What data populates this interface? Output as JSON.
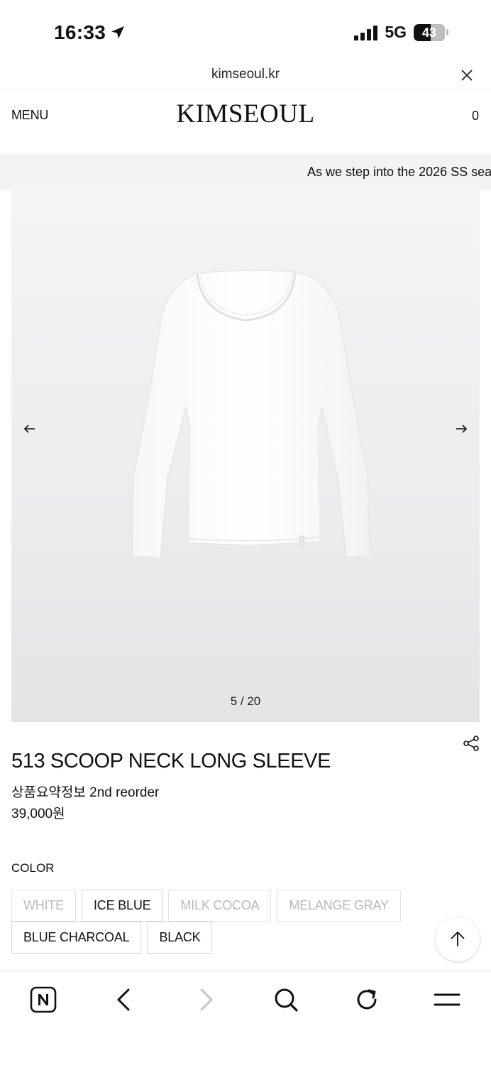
{
  "status_bar": {
    "time": "16:33",
    "network": "5G",
    "battery": "43",
    "icons": [
      "location-arrow-icon",
      "signal-icon",
      "battery-icon"
    ]
  },
  "browser": {
    "url": "kimseoul.kr",
    "close_icon": "close-icon"
  },
  "header": {
    "menu_label": "MENU",
    "logo": "KIMSEOUL",
    "cart_count": "0"
  },
  "marquee": {
    "text": "As we step into the 2026 SS sea"
  },
  "gallery": {
    "pager": "5 / 20",
    "current_index": 5,
    "total": 20,
    "prev_icon": "arrow-left-icon",
    "next_icon": "arrow-right-icon"
  },
  "product": {
    "name": "513 SCOOP NECK LONG SLEEVE",
    "subtitle": "상품요약정보 2nd reorder",
    "price": "39,000원",
    "share_icon": "share-icon"
  },
  "color": {
    "label": "COLOR",
    "row1": [
      {
        "label": "WHITE",
        "available": false
      },
      {
        "label": "ICE BLUE",
        "available": true
      },
      {
        "label": "MILK COCOA",
        "available": false
      },
      {
        "label": "MELANGE GRAY",
        "available": false
      }
    ],
    "row2": [
      {
        "label": "BLUE CHARCOAL",
        "available": true
      },
      {
        "label": "BLACK",
        "available": true
      }
    ]
  },
  "toolbar": {
    "items": [
      "naver-home-icon",
      "back-icon",
      "forward-icon",
      "search-icon",
      "reload-icon",
      "menu-icon"
    ]
  },
  "colors": {
    "marquee_bg": "#f3f3f3",
    "disabled_text": "#b9b9b9",
    "border": "#d6d6d6"
  }
}
